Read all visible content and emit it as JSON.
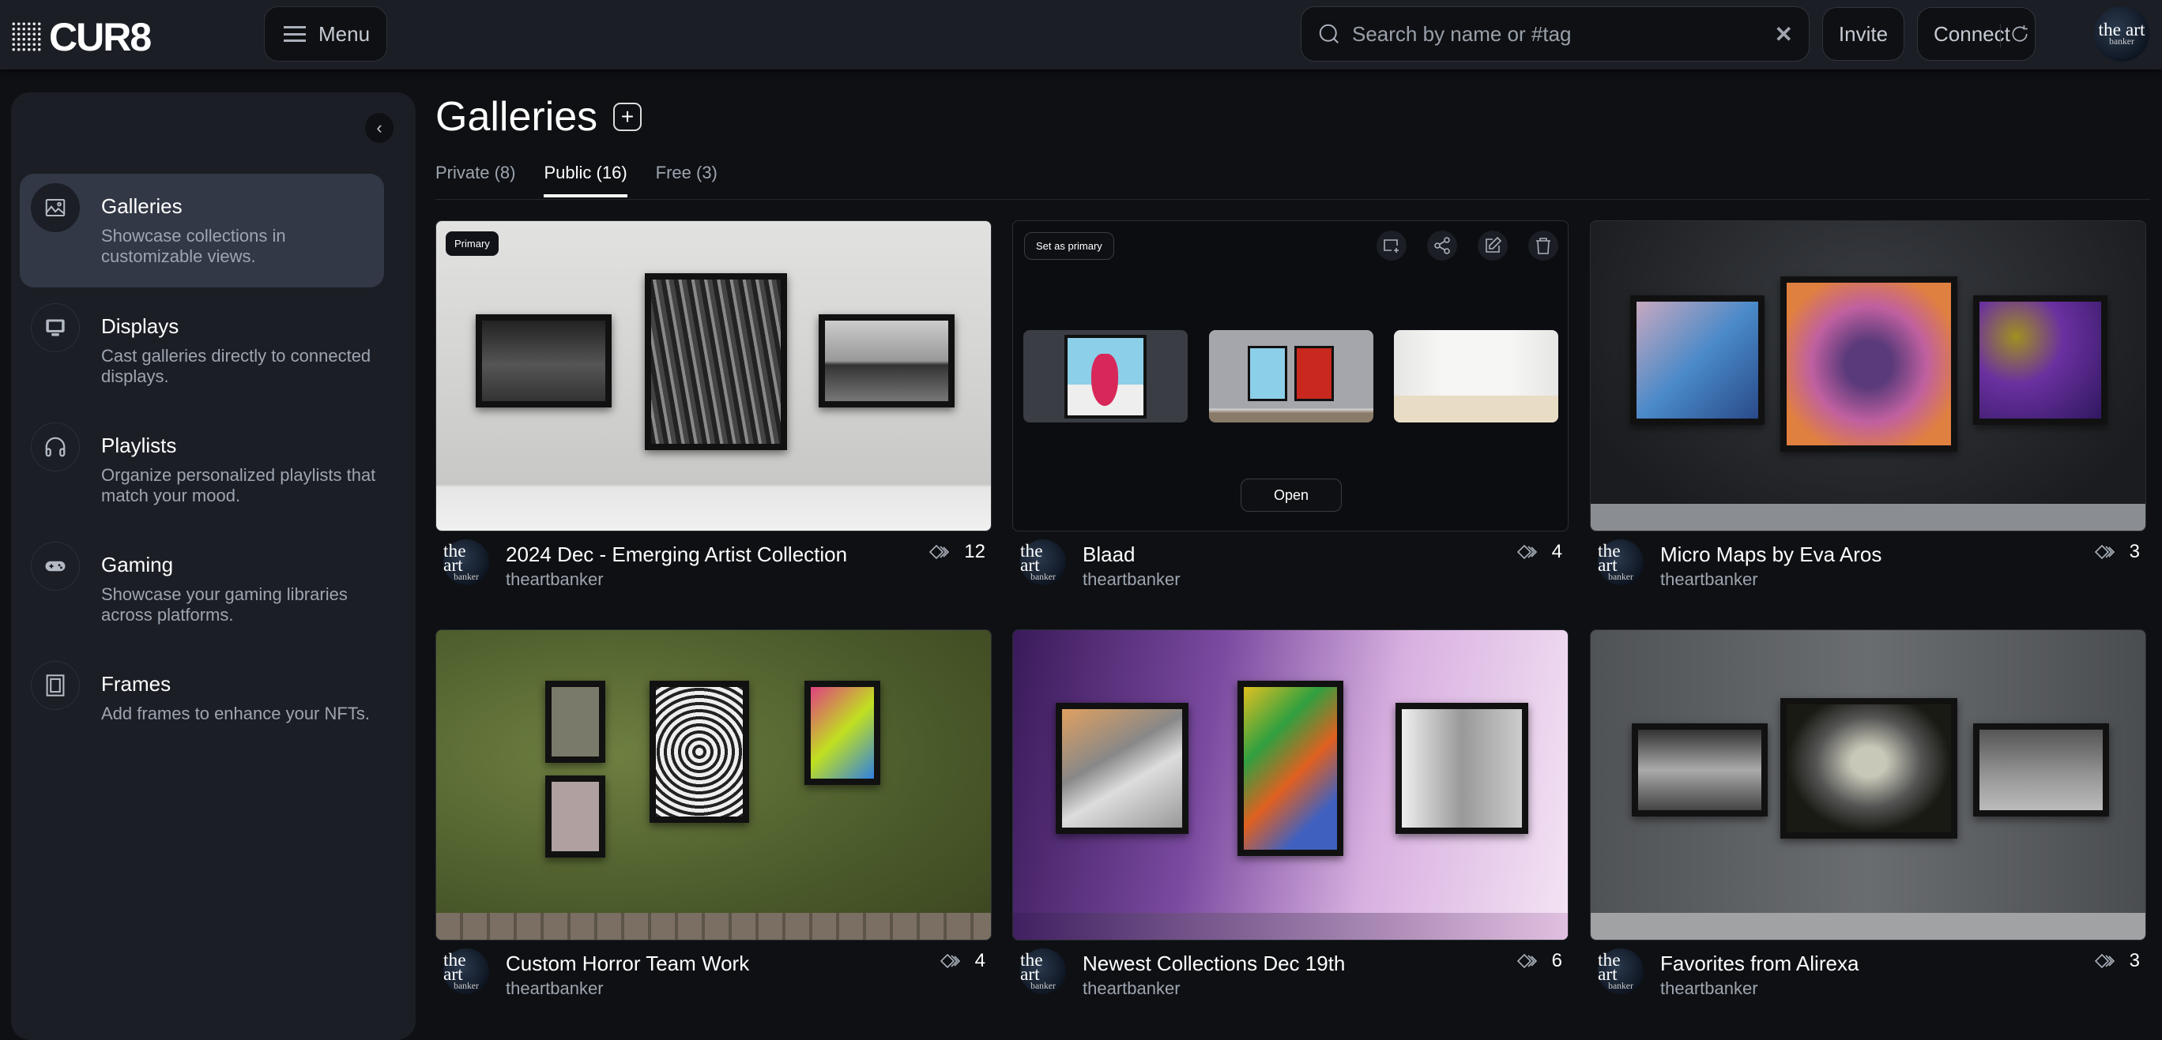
{
  "header": {
    "logo": "CUR8",
    "menu_label": "Menu",
    "search_placeholder": "Search by name or #tag",
    "invite_label": "Invite",
    "connect_label": "Connect",
    "avatar_text": {
      "top": "the art",
      "bottom": "banker"
    }
  },
  "sidebar": {
    "items": [
      {
        "label": "Galleries",
        "desc": "Showcase collections in customizable views.",
        "icon": "image-icon",
        "active": true
      },
      {
        "label": "Displays",
        "desc": "Cast galleries directly to connected displays.",
        "icon": "monitor-icon"
      },
      {
        "label": "Playlists",
        "desc": "Organize personalized playlists that match your mood.",
        "icon": "headphones-icon"
      },
      {
        "label": "Gaming",
        "desc": "Showcase your gaming libraries across platforms.",
        "icon": "gamepad-icon"
      },
      {
        "label": "Frames",
        "desc": "Add frames to enhance your NFTs.",
        "icon": "frame-icon"
      }
    ]
  },
  "main": {
    "title": "Galleries",
    "tabs": [
      {
        "label": "Private (8)"
      },
      {
        "label": "Public (16)",
        "active": true
      },
      {
        "label": "Free (3)"
      }
    ]
  },
  "cards": [
    {
      "title": "2024 Dec - Emerging Artist Collection",
      "author": "theartbanker",
      "count": "12",
      "badge": "Primary"
    },
    {
      "title": "Blaad",
      "author": "theartbanker",
      "count": "4",
      "set_primary": "Set as primary",
      "open": "Open"
    },
    {
      "title": "Micro Maps by Eva Aros",
      "author": "theartbanker",
      "count": "3"
    },
    {
      "title": "Custom Horror Team Work",
      "author": "theartbanker",
      "count": "4"
    },
    {
      "title": "Newest Collections Dec 19th",
      "author": "theartbanker",
      "count": "6"
    },
    {
      "title": "Favorites from Alirexa",
      "author": "theartbanker",
      "count": "3"
    }
  ]
}
